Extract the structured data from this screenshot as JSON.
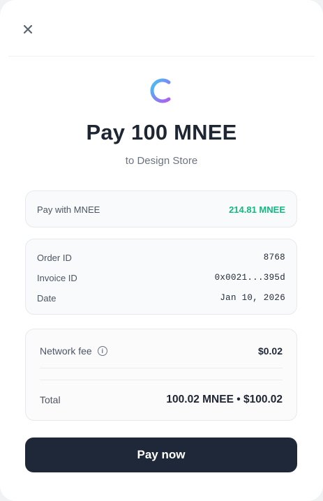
{
  "header": {
    "close_icon": "close-icon"
  },
  "brand": {
    "logo_icon": "mnee-logo-icon",
    "gradient": [
      "#3ec8f0",
      "#7b8cf5",
      "#b05df2"
    ]
  },
  "payment": {
    "title": "Pay 100 MNEE",
    "subtitle": "to Design Store"
  },
  "pay_with": {
    "label": "Pay with MNEE",
    "balance": "214.81 MNEE",
    "balance_color": "#10b981"
  },
  "details": [
    {
      "label": "Order ID",
      "value": "8768"
    },
    {
      "label": "Invoice ID",
      "value": "0x0021...395d"
    },
    {
      "label": "Date",
      "value": "Jan 10, 2026"
    }
  ],
  "summary": {
    "network_fee_label": "Network fee",
    "network_fee_icon": "info-icon",
    "network_fee_value": "$0.02",
    "total_label": "Total",
    "total_value": "100.02 MNEE • $100.02"
  },
  "actions": {
    "pay_label": "Pay now",
    "pay_color": "#1f2839"
  }
}
